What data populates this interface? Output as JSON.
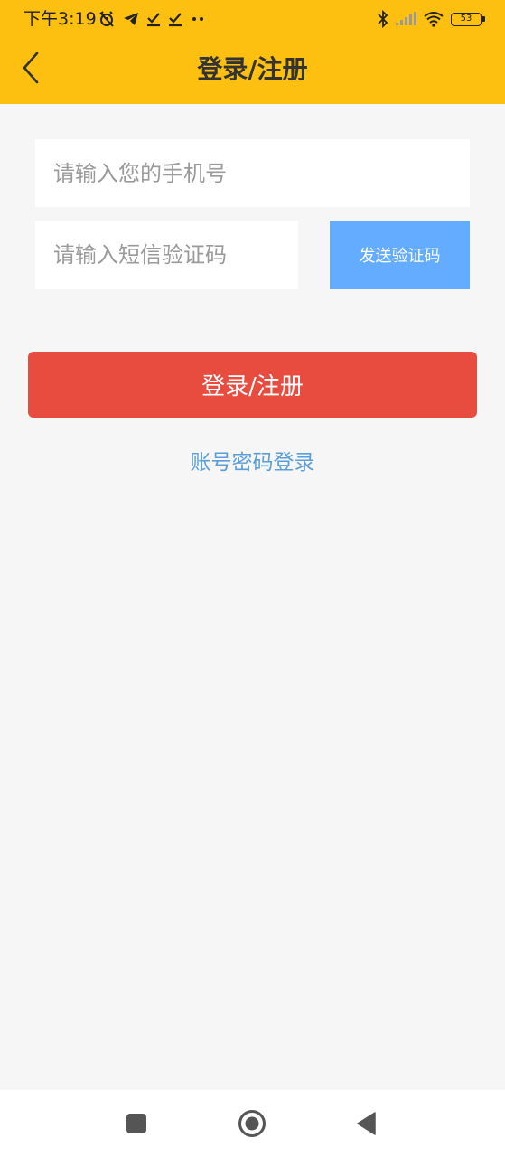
{
  "status_bar": {
    "time": "下午3:19",
    "battery_level": "53",
    "icons": [
      "alarm-off-icon",
      "telegram-icon",
      "download-done-icon",
      "download-done-icon",
      "more-dots-icon",
      "bluetooth-icon",
      "signal-icon",
      "wifi-icon",
      "battery-icon"
    ]
  },
  "app_bar": {
    "title": "登录/注册",
    "back_icon": "chevron-left-icon"
  },
  "form": {
    "phone_placeholder": "请输入您的手机号",
    "phone_value": "",
    "code_placeholder": "请输入短信验证码",
    "code_value": "",
    "send_code_label": "发送验证码",
    "submit_label": "登录/注册",
    "password_login_label": "账号密码登录"
  },
  "nav_bar": {
    "icons": [
      "recents-square-icon",
      "home-circle-icon",
      "back-triangle-icon"
    ]
  },
  "colors": {
    "header_bg": "#fdbf10",
    "page_bg": "#f6f6f6",
    "send_code_bg": "#64acff",
    "submit_bg": "#e74c3f",
    "link_color": "#5b9fd9"
  }
}
